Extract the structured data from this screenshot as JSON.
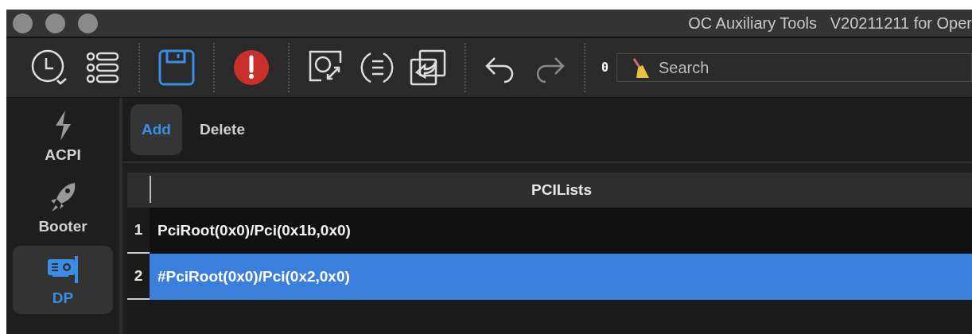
{
  "window": {
    "title": "OC Auxiliary Tools   V20211211 for Oper"
  },
  "toolbar": {
    "counter": "0",
    "search": {
      "placeholder": "Search"
    }
  },
  "sidebar": {
    "items": [
      {
        "label": "ACPI",
        "kind": "bolt",
        "selected": false
      },
      {
        "label": "Booter",
        "kind": "rocket",
        "selected": false
      },
      {
        "label": "DP",
        "kind": "card",
        "selected": true
      }
    ]
  },
  "subtabs": [
    {
      "label": "Add",
      "selected": true
    },
    {
      "label": "Delete",
      "selected": false
    }
  ],
  "table": {
    "columns": [
      "PCILists"
    ],
    "rows": [
      {
        "number": "1",
        "value": "PciRoot(0x0)/Pci(0x1b,0x0)",
        "selected": false
      },
      {
        "number": "2",
        "value": "#PciRoot(0x0)/Pci(0x2,0x0)",
        "selected": true
      }
    ]
  }
}
